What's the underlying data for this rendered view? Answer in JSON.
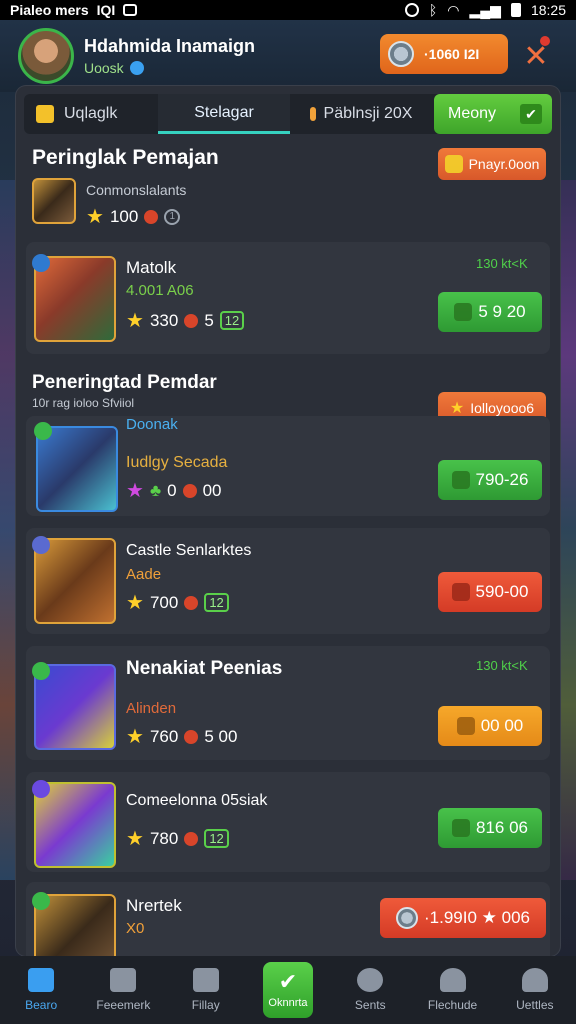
{
  "status_bar": {
    "left_text": "Pialeo mers",
    "left_badge": "IQI",
    "time": "18:25"
  },
  "header": {
    "profile_name": "Hdahmida Inamaign",
    "profile_sub": "Uoosk",
    "coins": "·1060 I2I"
  },
  "tabs": [
    {
      "label": "Uqlaglk"
    },
    {
      "label": "Stelagar"
    },
    {
      "label": "Päblnsji 20X"
    },
    {
      "label": "Meony"
    }
  ],
  "section1": {
    "title": "Peringlak Pemajan",
    "sub": "Conmonslalants",
    "stats_value": "100",
    "stats_count": "1",
    "action_label": "Pnayr.0oon"
  },
  "cards": [
    {
      "title": "Matolk",
      "sub": "4.001 A06",
      "score": "330",
      "extra": "5",
      "box": "12",
      "tiny": "130 kt<K",
      "button": "5 9 20"
    },
    {
      "title": "Iudlgy Secada",
      "sub": "",
      "score": "0",
      "extra": "00",
      "box": "",
      "tiny": "",
      "button": "790-26"
    },
    {
      "title": "Castle Senlarktes",
      "sub": "Aade",
      "score": "700",
      "extra": "",
      "box": "12",
      "tiny": "",
      "button": "590-00"
    },
    {
      "title": "Nenakiat Peenias",
      "sub": "Alinden",
      "score": "760",
      "extra": "5 00",
      "box": "",
      "tiny": "130 kt<K",
      "button": "00 00"
    },
    {
      "title": "Comeelonna 05siak",
      "sub": "",
      "score": "780",
      "extra": "",
      "box": "12",
      "tiny": "",
      "button": "816 06"
    },
    {
      "title": "Nrertek",
      "sub": "X0",
      "score": "",
      "extra": "",
      "box": "",
      "tiny": "",
      "button": "·1.99I0 ★ 006"
    }
  ],
  "section2": {
    "title": "Peneringtad Pemdar",
    "sub": "10r rag ioloo Sfviiol",
    "sub2": "Doonak",
    "action_label": "Iolloyooo6"
  },
  "bottom_nav": [
    {
      "label": "Bearo"
    },
    {
      "label": "Feeemerk"
    },
    {
      "label": "Fillay"
    },
    {
      "label": "Oknnrta"
    },
    {
      "label": "Sents"
    },
    {
      "label": "Flechude"
    },
    {
      "label": "Uettles"
    }
  ],
  "colors": {
    "accent_green": "#48c24a",
    "accent_orange": "#f0793a",
    "accent_red": "#ef5a3a",
    "accent_blue": "#3a9ef0"
  }
}
